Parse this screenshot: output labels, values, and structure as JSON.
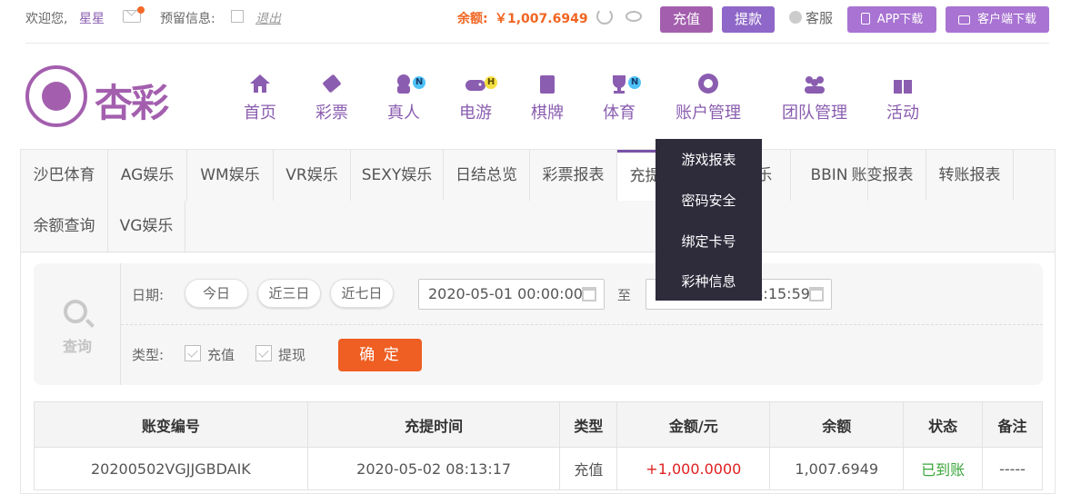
{
  "topbar": {
    "welcome": "欢迎您,",
    "username": "星星",
    "reserve_info": "预留信息:",
    "logout": "退出",
    "balance_label": "余额:",
    "balance_value": "￥1,007.6949",
    "recharge": "充值",
    "withdraw": "提款",
    "customer_service": "客服",
    "app_download": "APP下载",
    "client_download": "客户端下载"
  },
  "logo": {
    "text": "杏彩"
  },
  "nav": [
    {
      "label": "首页",
      "icon": "home-icon"
    },
    {
      "label": "彩票",
      "icon": "ticket-icon"
    },
    {
      "label": "真人",
      "icon": "dealer-icon",
      "badge": "N"
    },
    {
      "label": "电游",
      "icon": "gamepad-icon",
      "badge": "H"
    },
    {
      "label": "棋牌",
      "icon": "cards-icon"
    },
    {
      "label": "体育",
      "icon": "trophy-icon",
      "badge": "N"
    },
    {
      "label": "账户管理",
      "icon": "account-icon"
    },
    {
      "label": "团队管理",
      "icon": "team-icon"
    },
    {
      "label": "活动",
      "icon": "gift-icon"
    }
  ],
  "tabs": [
    "沙巴体育",
    "AG娱乐",
    "WM娱乐",
    "VR娱乐",
    "SEXY娱乐",
    "日结总览",
    "彩票报表",
    "充提记录",
    "PT娱乐",
    "BBIN",
    "账变报表",
    "转账报表",
    "余额查询",
    "VG娱乐"
  ],
  "active_tab": "充提记录",
  "dropdown": [
    "游戏报表",
    "密码安全",
    "绑定卡号",
    "彩种信息"
  ],
  "filter": {
    "query_label": "查询",
    "date_label": "日期:",
    "quick": [
      "今日",
      "近三日",
      "近七日"
    ],
    "start": "2020-05-01 00:00:00",
    "to": "至",
    "end": "2020-05-02 08:15:59",
    "type_label": "类型:",
    "types": [
      "充值",
      "提现"
    ],
    "confirm": "确 定"
  },
  "table": {
    "headers": [
      "账变编号",
      "充提时间",
      "类型",
      "金额/元",
      "余额",
      "状态",
      "备注"
    ],
    "rows": [
      [
        "20200502VGJJGBDAIK",
        "2020-05-02 08:13:17",
        "充值",
        "+1,000.0000",
        "1,007.6949",
        "已到账",
        "-----"
      ]
    ]
  },
  "colors": {
    "brand": "#a35fae",
    "accent": "#f16522",
    "dropdown_bg": "#2e2b3b"
  }
}
